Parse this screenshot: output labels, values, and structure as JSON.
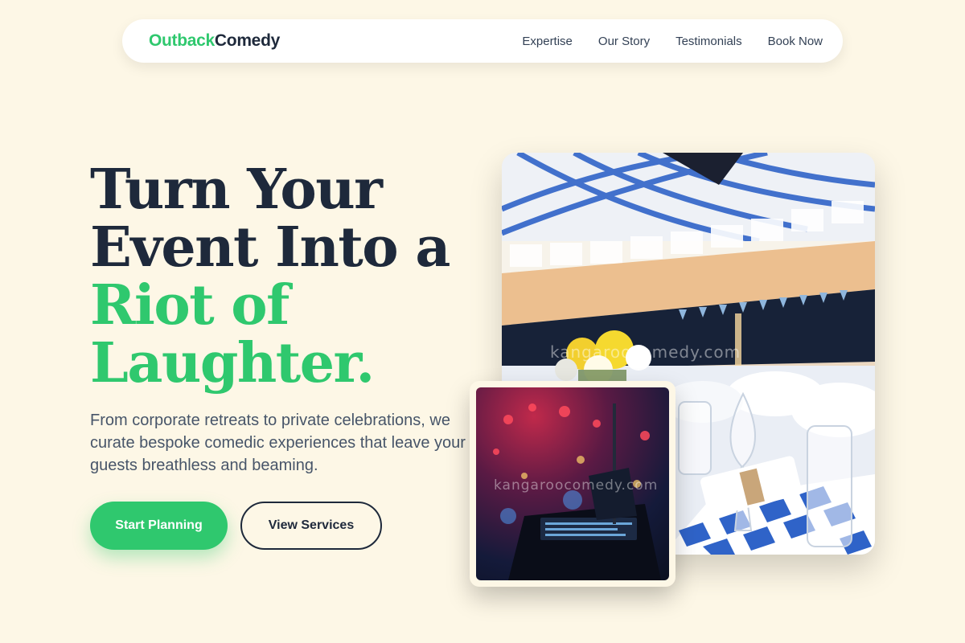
{
  "nav": {
    "logo_part1": "Outback",
    "logo_part2": "Comedy",
    "links": [
      "Expertise",
      "Our Story",
      "Testimonials",
      "Book Now"
    ]
  },
  "hero": {
    "headline_line1": "Turn Your",
    "headline_line2": "Event Into a",
    "headline_accent1": "Riot of",
    "headline_accent2": "Laughter.",
    "subtitle": "From corporate retreats to private celebrations, we curate bespoke comedic experiences that leave your guests breathless and beaming.",
    "primary_button": "Start Planning",
    "secondary_button": "View Services"
  },
  "images": {
    "main_watermark": "kangaroocomedy.com",
    "small_watermark": "kangaroocomedy.com"
  },
  "colors": {
    "background": "#fdf7e6",
    "accent": "#2fc86e",
    "text_dark": "#1e293b"
  }
}
